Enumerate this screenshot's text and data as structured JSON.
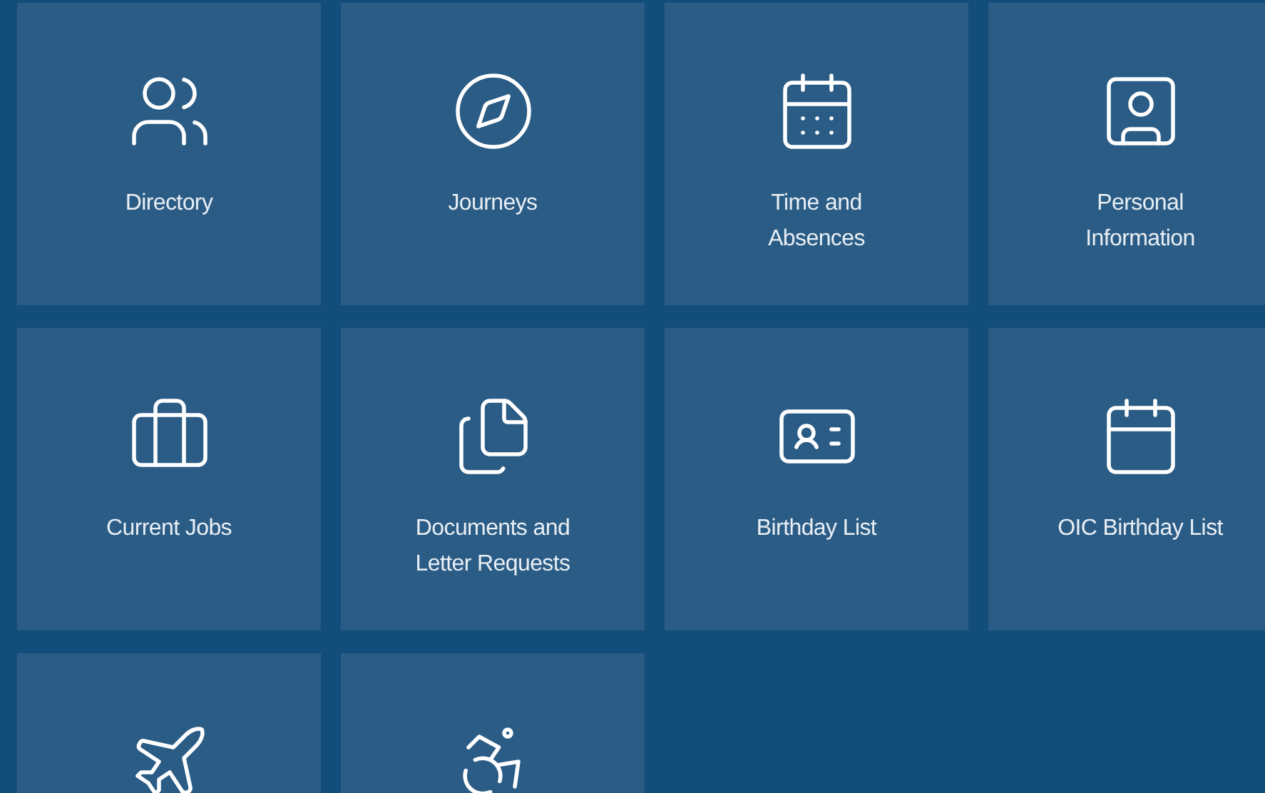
{
  "tiles": [
    {
      "label": "Directory"
    },
    {
      "label": "Journeys"
    },
    {
      "label": "Time and Absences"
    },
    {
      "label": "Personal Information"
    },
    {
      "label": "Current Jobs"
    },
    {
      "label": "Documents and Letter Requests"
    },
    {
      "label": "Birthday List"
    },
    {
      "label": "OIC Birthday List"
    }
  ]
}
